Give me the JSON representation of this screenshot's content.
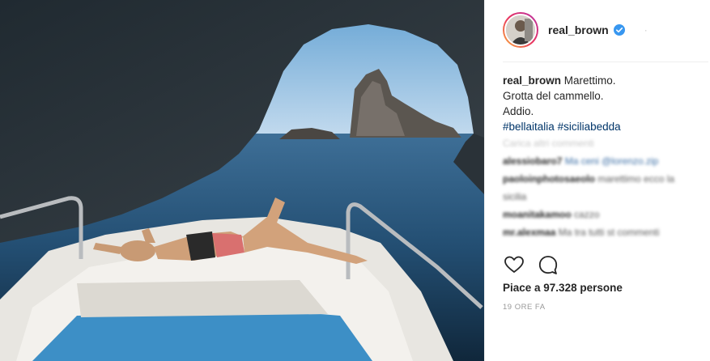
{
  "post": {
    "username": "real_brown",
    "verified": true,
    "caption_username": "real_brown",
    "caption_lines": [
      "Marettimo.",
      "Grotta del cammello.",
      "Addio."
    ],
    "hashtags": [
      "#bellaitalia",
      "#siciliabedda"
    ],
    "load_more_comments": "Carica altri commenti",
    "comments": [
      {
        "user": "alessiobaro7",
        "text": "Ma ceni @lorenzo.zip"
      },
      {
        "user": "paoloinphotosaeolo",
        "text": "marettimo ecco la"
      },
      {
        "user": "",
        "text": "sicilia"
      },
      {
        "user": "moanitakamoo",
        "text": "cazzo"
      },
      {
        "user": "mr.alexmaa",
        "text": "Ma tra tutti st commenti"
      }
    ],
    "likes_text": "Piace a 97.328 persone",
    "timestamp": "19 ORE FA"
  },
  "icons": {
    "verified": "verified-badge-icon",
    "like": "heart-icon",
    "comment": "comment-bubble-icon"
  },
  "colors": {
    "hashtag": "#003569",
    "verified": "#3897f0",
    "muted": "#999999"
  }
}
